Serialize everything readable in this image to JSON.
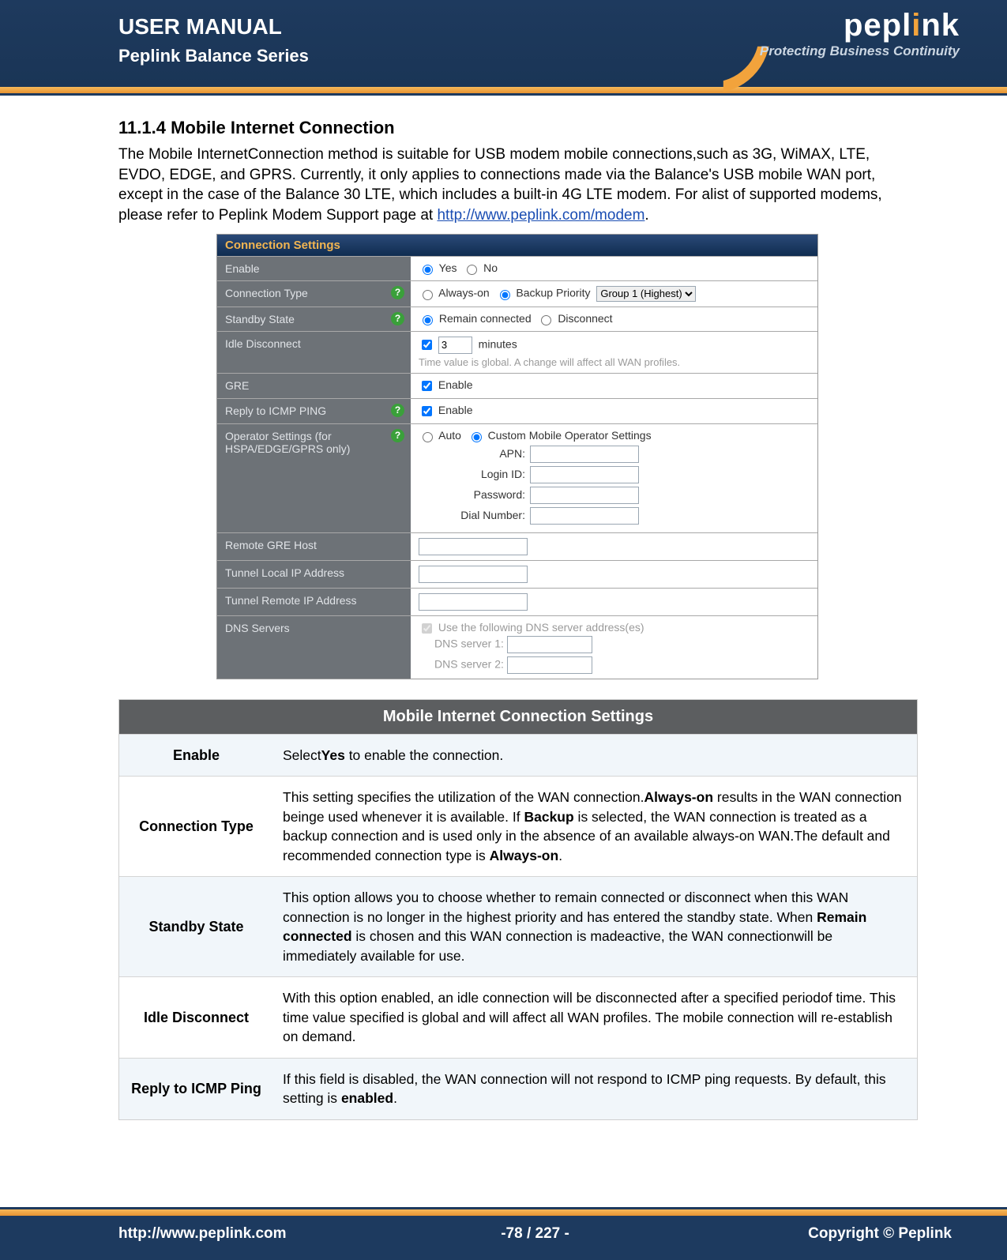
{
  "header": {
    "title": "USER MANUAL",
    "subtitle": "Peplink Balance Series",
    "brand_pre": "pepl",
    "brand_i": "i",
    "brand_post": "nk",
    "tagline": "Protecting Business Continuity"
  },
  "section": {
    "number_title": "11.1.4 Mobile Internet Connection",
    "para1": "The Mobile InternetConnection method is suitable for USB modem mobile connections,such as 3G, WiMAX, LTE, EVDO, EDGE, and GPRS. Currently, it only applies to connections made via the Balance's USB mobile WAN port, except in the case of the Balance 30 LTE, which includes a built-in 4G LTE modem. For alist of supported modems, please refer to Peplink Modem Support page at ",
    "link_text": "http://www.peplink.com/modem",
    "period": "."
  },
  "shot": {
    "title": "Connection Settings",
    "enable": {
      "label": "Enable",
      "yes": "Yes",
      "no": "No"
    },
    "conn_type": {
      "label": "Connection Type",
      "always": "Always-on",
      "backup": "Backup Priority",
      "select": "Group 1 (Highest)"
    },
    "standby": {
      "label": "Standby State",
      "remain": "Remain connected",
      "disc": "Disconnect"
    },
    "idle": {
      "label": "Idle Disconnect",
      "val": "3",
      "unit": "minutes",
      "note": "Time value is global. A change will affect all WAN profiles."
    },
    "gre": {
      "label": "GRE",
      "enable": "Enable"
    },
    "icmp": {
      "label": "Reply to ICMP PING",
      "enable": "Enable"
    },
    "oper": {
      "label": "Operator Settings (for HSPA/EDGE/GPRS only)",
      "auto": "Auto",
      "custom": "Custom Mobile Operator Settings",
      "apn": "APN:",
      "login": "Login ID:",
      "pwd": "Password:",
      "dial": "Dial Number:"
    },
    "rgre": {
      "label": "Remote GRE Host"
    },
    "tlocal": {
      "label": "Tunnel Local IP Address"
    },
    "tremote": {
      "label": "Tunnel Remote IP Address"
    },
    "dns": {
      "label": "DNS Servers",
      "use": "Use the following DNS server address(es)",
      "s1": "DNS server 1:",
      "s2": "DNS server 2:"
    }
  },
  "table": {
    "title": "Mobile Internet Connection Settings",
    "rows": [
      {
        "name": "Enable",
        "html": "Select<b>Yes</b> to enable the connection."
      },
      {
        "name": "Connection Type",
        "html": "This setting specifies the utilization of the WAN connection.<b>Always-on</b> results in the WAN connection beinge used whenever it is available. If <b>Backup</b> is selected, the WAN connection is treated as a backup connection and is used only in the absence of an available always-on WAN.The default and recommended connection type is <b>Always-on</b>."
      },
      {
        "name": "Standby State",
        "html": "This option allows you to choose whether to  remain connected or disconnect when this WAN connection is no longer in the highest priority and has entered the standby state. When <b>Remain connected</b> is chosen and this WAN connection is madeactive, the WAN connectionwill be immediately available for use."
      },
      {
        "name": "Idle Disconnect",
        "html": "With this option enabled, an idle connection will be disconnected after a specified periodof time. This time value specified is global and will affect all WAN profiles. The mobile connection will re-establish on demand."
      },
      {
        "name": "Reply to ICMP Ping",
        "html": "If this field is disabled, the WAN connection will not respond to ICMP ping requests. By default, this setting is <b>enabled</b>."
      }
    ]
  },
  "footer": {
    "url": "http://www.peplink.com",
    "page": "-78 / 227 -",
    "copy": "Copyright ©  Peplink"
  }
}
